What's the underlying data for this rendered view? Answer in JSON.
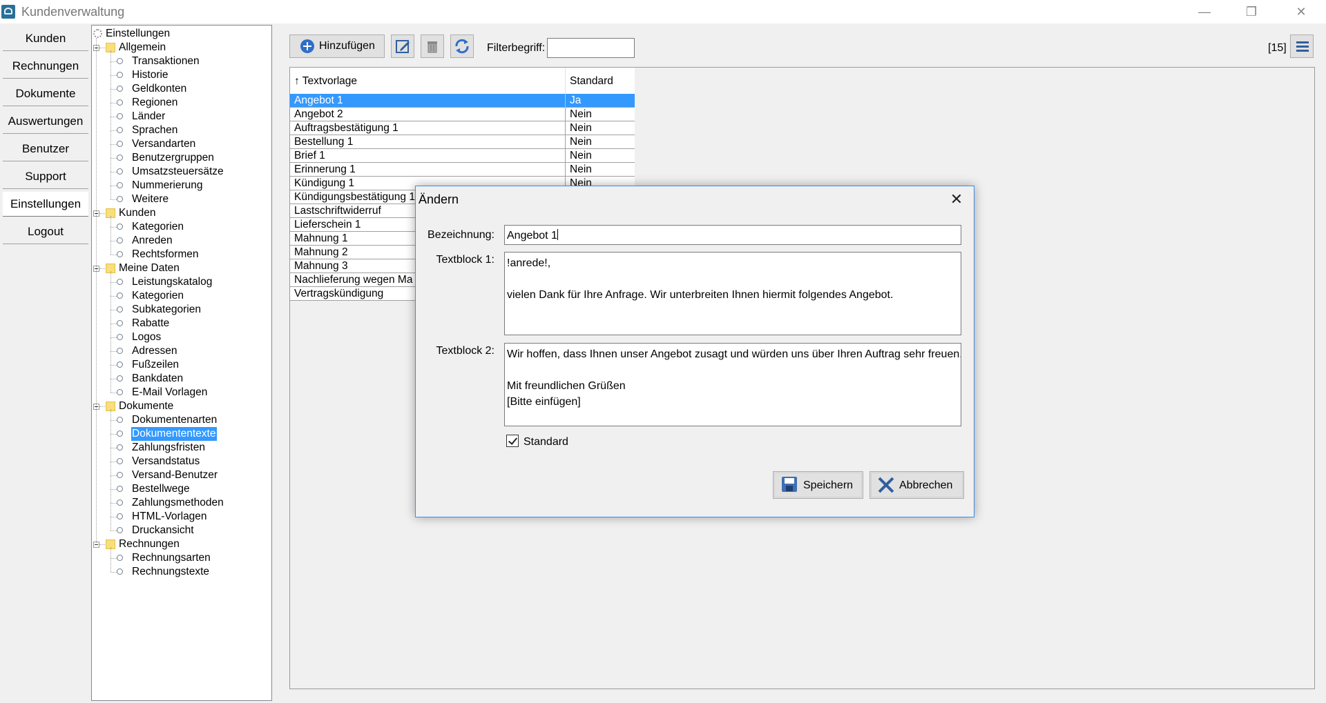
{
  "app": {
    "title": "Kundenverwaltung"
  },
  "window_controls": {
    "minimize": "—",
    "restore": "❐",
    "close": "✕"
  },
  "nav": {
    "items": [
      "Kunden",
      "Rechnungen",
      "Dokumente",
      "Auswertungen",
      "Benutzer",
      "Support",
      "Einstellungen",
      "Logout"
    ],
    "active": "Einstellungen"
  },
  "tree": {
    "root": "Einstellungen",
    "groups": [
      {
        "label": "Allgemein",
        "items": [
          "Transaktionen",
          "Historie",
          "Geldkonten",
          "Regionen",
          "Länder",
          "Sprachen",
          "Versandarten",
          "Benutzergruppen",
          "Umsatzsteuersätze",
          "Nummerierung",
          "Weitere"
        ]
      },
      {
        "label": "Kunden",
        "items": [
          "Kategorien",
          "Anreden",
          "Rechtsformen"
        ]
      },
      {
        "label": "Meine Daten",
        "items": [
          "Leistungskatalog",
          "Kategorien",
          "Subkategorien",
          "Rabatte",
          "Logos",
          "Adressen",
          "Fußzeilen",
          "Bankdaten",
          "E-Mail Vorlagen"
        ]
      },
      {
        "label": "Dokumente",
        "items": [
          "Dokumentenarten",
          "Dokumententexte",
          "Zahlungsfristen",
          "Versandstatus",
          "Versand-Benutzer",
          "Bestellwege",
          "Zahlungsmethoden",
          "HTML-Vorlagen",
          "Druckansicht"
        ]
      },
      {
        "label": "Rechnungen",
        "items": [
          "Rechnungsarten",
          "Rechnungstexte"
        ]
      }
    ],
    "selected": "Dokumententexte"
  },
  "toolbar": {
    "add_label": "Hinzufügen",
    "filter_label": "Filterbegriff:",
    "filter_value": "",
    "count": "[15]"
  },
  "grid": {
    "columns": [
      "↑ Textvorlage",
      "Standard"
    ],
    "rows": [
      [
        "Angebot 1",
        "Ja"
      ],
      [
        "Angebot 2",
        "Nein"
      ],
      [
        "Auftragsbestätigung 1",
        "Nein"
      ],
      [
        "Bestellung 1",
        "Nein"
      ],
      [
        "Brief 1",
        "Nein"
      ],
      [
        "Erinnerung 1",
        "Nein"
      ],
      [
        "Kündigung 1",
        "Nein"
      ],
      [
        "Kündigungsbestätigung 1",
        ""
      ],
      [
        "Lastschriftwiderruf",
        ""
      ],
      [
        "Lieferschein 1",
        ""
      ],
      [
        "Mahnung 1",
        ""
      ],
      [
        "Mahnung 2",
        ""
      ],
      [
        "Mahnung 3",
        ""
      ],
      [
        "Nachlieferung wegen Ma",
        ""
      ],
      [
        "Vertragskündigung",
        ""
      ]
    ],
    "selected_index": 0
  },
  "dialog": {
    "title": "Ändern",
    "close": "✕",
    "bezeichnung_label": "Bezeichnung:",
    "bezeichnung_value": "Angebot 1",
    "textblock1_label": "Textblock 1:",
    "textblock1_value": "!anrede!,\n\nvielen Dank für Ihre Anfrage. Wir unterbreiten Ihnen hiermit folgendes Angebot.",
    "textblock2_label": "Textblock 2:",
    "textblock2_value": "Wir hoffen, dass Ihnen unser Angebot zusagt und würden uns über Ihren Auftrag sehr freuen.\n\nMit freundlichen Grüßen\n[Bitte einfügen]",
    "standard_label": "Standard",
    "standard_checked": true,
    "save_label": "Speichern",
    "cancel_label": "Abbrechen"
  }
}
